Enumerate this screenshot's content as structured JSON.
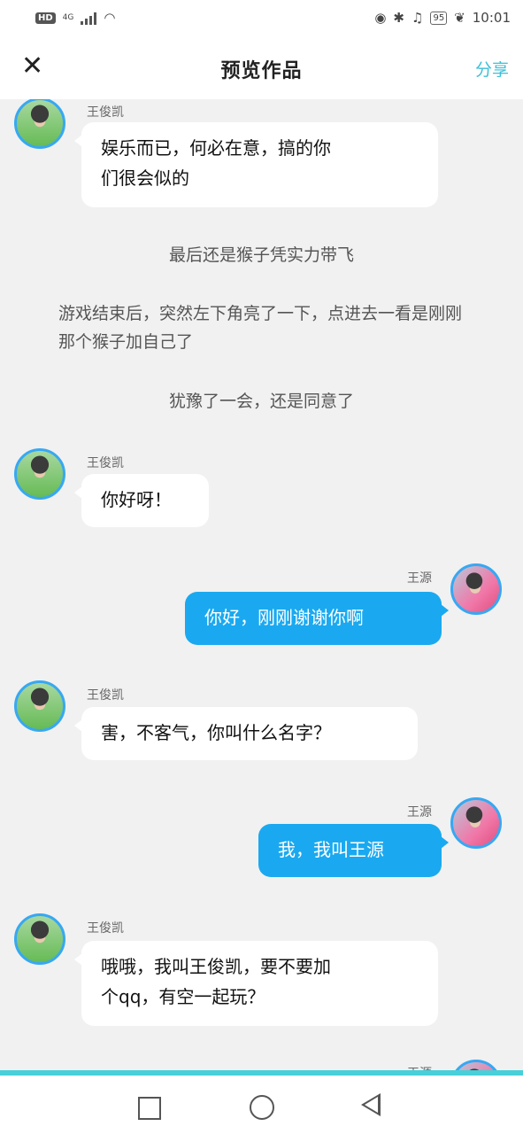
{
  "status": {
    "hd": "HD",
    "network": "4G",
    "battery": "95",
    "time": "10:01"
  },
  "header": {
    "close": "✕",
    "title": "预览作品",
    "share": "分享"
  },
  "messages": [
    {
      "name": "王俊凯",
      "text": "娱乐而已，何必在意，搞的你\n们很会似的"
    },
    {
      "narration": "最后还是猴子凭实力带飞"
    },
    {
      "narration": "游戏结束后，突然左下角亮了一下，点进去一看是刚刚那个猴子加自己了"
    },
    {
      "narration": "犹豫了一会，还是同意了"
    },
    {
      "name": "王俊凯",
      "text": "你好呀！"
    },
    {
      "name": "王源",
      "text": "你好，刚刚谢谢你啊"
    },
    {
      "name": "王俊凯",
      "text": "害，不客气，你叫什么名字？"
    },
    {
      "name": "王源",
      "text": "我，我叫王源"
    },
    {
      "name": "王俊凯",
      "text": "哦哦，我叫王俊凯，要不要加\n个qq，有空一起玩？"
    },
    {
      "name": "王源"
    }
  ]
}
